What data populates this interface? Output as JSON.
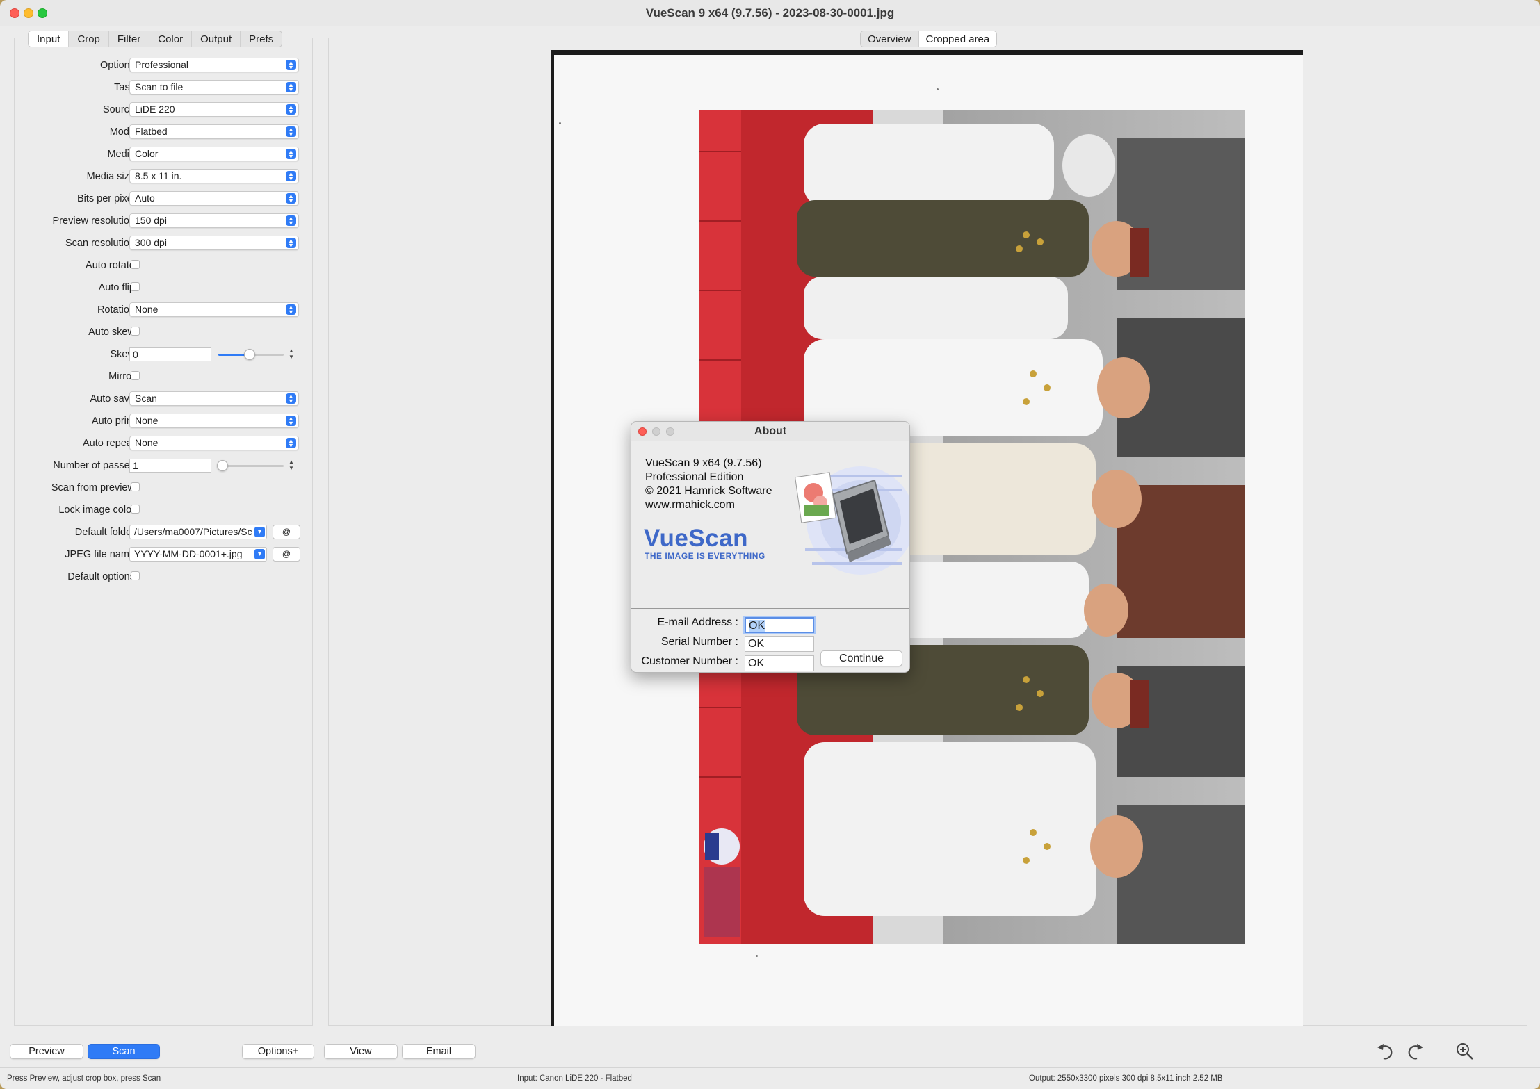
{
  "window": {
    "title": "VueScan 9 x64 (9.7.56) - 2023-08-30-0001.jpg"
  },
  "left_tabs": [
    "Input",
    "Crop",
    "Filter",
    "Color",
    "Output",
    "Prefs"
  ],
  "view_tabs": [
    "Overview",
    "Cropped area"
  ],
  "settings": {
    "options": {
      "label": "Options:",
      "value": "Professional"
    },
    "task": {
      "label": "Task:",
      "value": "Scan to file"
    },
    "source": {
      "label": "Source:",
      "value": "LiDE 220"
    },
    "mode": {
      "label": "Mode:",
      "value": "Flatbed"
    },
    "media": {
      "label": "Media:",
      "value": "Color"
    },
    "media_size": {
      "label": "Media size:",
      "value": "8.5 x 11 in."
    },
    "bits_per_pixel": {
      "label": "Bits per pixel:",
      "value": "Auto"
    },
    "preview_resolution": {
      "label": "Preview resolution:",
      "value": "150 dpi"
    },
    "scan_resolution": {
      "label": "Scan resolution:",
      "value": "300 dpi"
    },
    "auto_rotate": {
      "label": "Auto rotate:"
    },
    "auto_flip": {
      "label": "Auto flip:"
    },
    "rotation": {
      "label": "Rotation:",
      "value": "None"
    },
    "auto_skew": {
      "label": "Auto skew:"
    },
    "skew": {
      "label": "Skew:",
      "value": "0"
    },
    "mirror": {
      "label": "Mirror:"
    },
    "auto_save": {
      "label": "Auto save:",
      "value": "Scan"
    },
    "auto_print": {
      "label": "Auto print:",
      "value": "None"
    },
    "auto_repeat": {
      "label": "Auto repeat:",
      "value": "None"
    },
    "number_of_passes": {
      "label": "Number of passes:",
      "value": "1"
    },
    "scan_from_preview": {
      "label": "Scan from preview:"
    },
    "lock_image_color": {
      "label": "Lock image color:"
    },
    "default_folder": {
      "label": "Default folder:",
      "value": "/Users/ma0007/Pictures/Sc",
      "at": "@"
    },
    "jpeg_file_name": {
      "label": "JPEG file name:",
      "value": "YYYY-MM-DD-0001+.jpg",
      "at": "@"
    },
    "default_options": {
      "label": "Default options:"
    }
  },
  "about": {
    "title": "About",
    "lines": [
      "VueScan 9 x64 (9.7.56)",
      "Professional Edition",
      "© 2021 Hamrick Software",
      "www.rmahick.com"
    ],
    "logo": "VueScan",
    "tagline": "THE IMAGE IS EVERYTHING",
    "email_label": "E-mail Address :",
    "email_value": "OK",
    "serial_label": "Serial Number :",
    "serial_value": "OK",
    "customer_label": "Customer Number :",
    "customer_value": "OK",
    "continue_label": "Continue"
  },
  "bottom": {
    "preview": "Preview",
    "scan": "Scan",
    "options_plus": "Options+",
    "view": "View",
    "email": "Email"
  },
  "status": {
    "left": "Press Preview, adjust crop box, press Scan",
    "center": "Input: Canon LiDE 220 - Flatbed",
    "right": "Output: 2550x3300 pixels 300 dpi 8.5x11 inch 2.52 MB"
  },
  "colors": {
    "accent": "#2f7bf6",
    "close": "#fe5f57",
    "minimize": "#febc2e",
    "maximize": "#28c840",
    "logo": "#3e68c8"
  },
  "icons": [
    "rotate-left-icon",
    "rotate-right-icon",
    "zoom-in-icon"
  ]
}
